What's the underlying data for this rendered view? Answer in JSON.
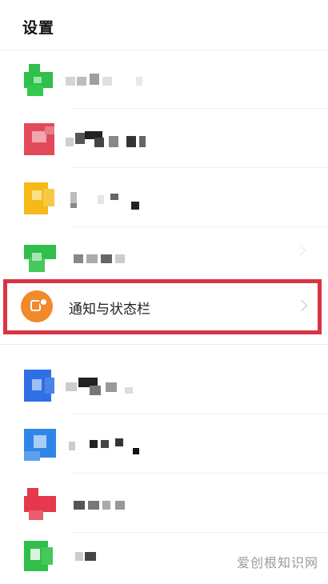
{
  "header": {
    "title": "设置"
  },
  "notification_item": {
    "label": "通知与状态栏"
  },
  "watermark": {
    "text": "爱创根知识网"
  },
  "colors": {
    "highlight": "#d93445",
    "notification_icon": "#f08a2b",
    "green": "#2fbf4a",
    "red": "#e24a5a",
    "yellow": "#f6b917",
    "blue": "#2f6fe4",
    "light_blue": "#2f86e8"
  }
}
